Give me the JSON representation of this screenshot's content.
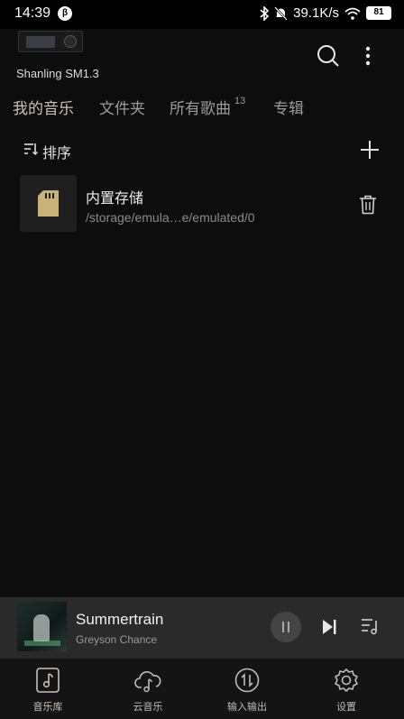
{
  "status_bar": {
    "time": "14:39",
    "speed": "39.1K/s",
    "battery": "81"
  },
  "header": {
    "device_name": "Shanling SM1.3"
  },
  "tabs": [
    {
      "label": "我的音乐",
      "active": true
    },
    {
      "label": "文件夹"
    },
    {
      "label": "所有歌曲",
      "count": "13"
    },
    {
      "label": "专辑"
    }
  ],
  "sort": {
    "label": "排序"
  },
  "storage": {
    "name": "内置存储",
    "path": "/storage/emula…e/emulated/0"
  },
  "now_playing": {
    "title": "Summertrain",
    "artist": "Greyson Chance"
  },
  "nav": {
    "items": [
      {
        "label": "音乐库",
        "icon": "music-note-icon",
        "active": true
      },
      {
        "label": "云音乐",
        "icon": "cloud-music-icon"
      },
      {
        "label": "输入输出",
        "icon": "input-output-icon"
      },
      {
        "label": "设置",
        "icon": "gear-icon"
      }
    ]
  },
  "colors": {
    "background": "#0d0d0d",
    "accent": "#c9c4b2",
    "sd_card": "#c8b27a",
    "player_bar": "#2a2a2a"
  }
}
